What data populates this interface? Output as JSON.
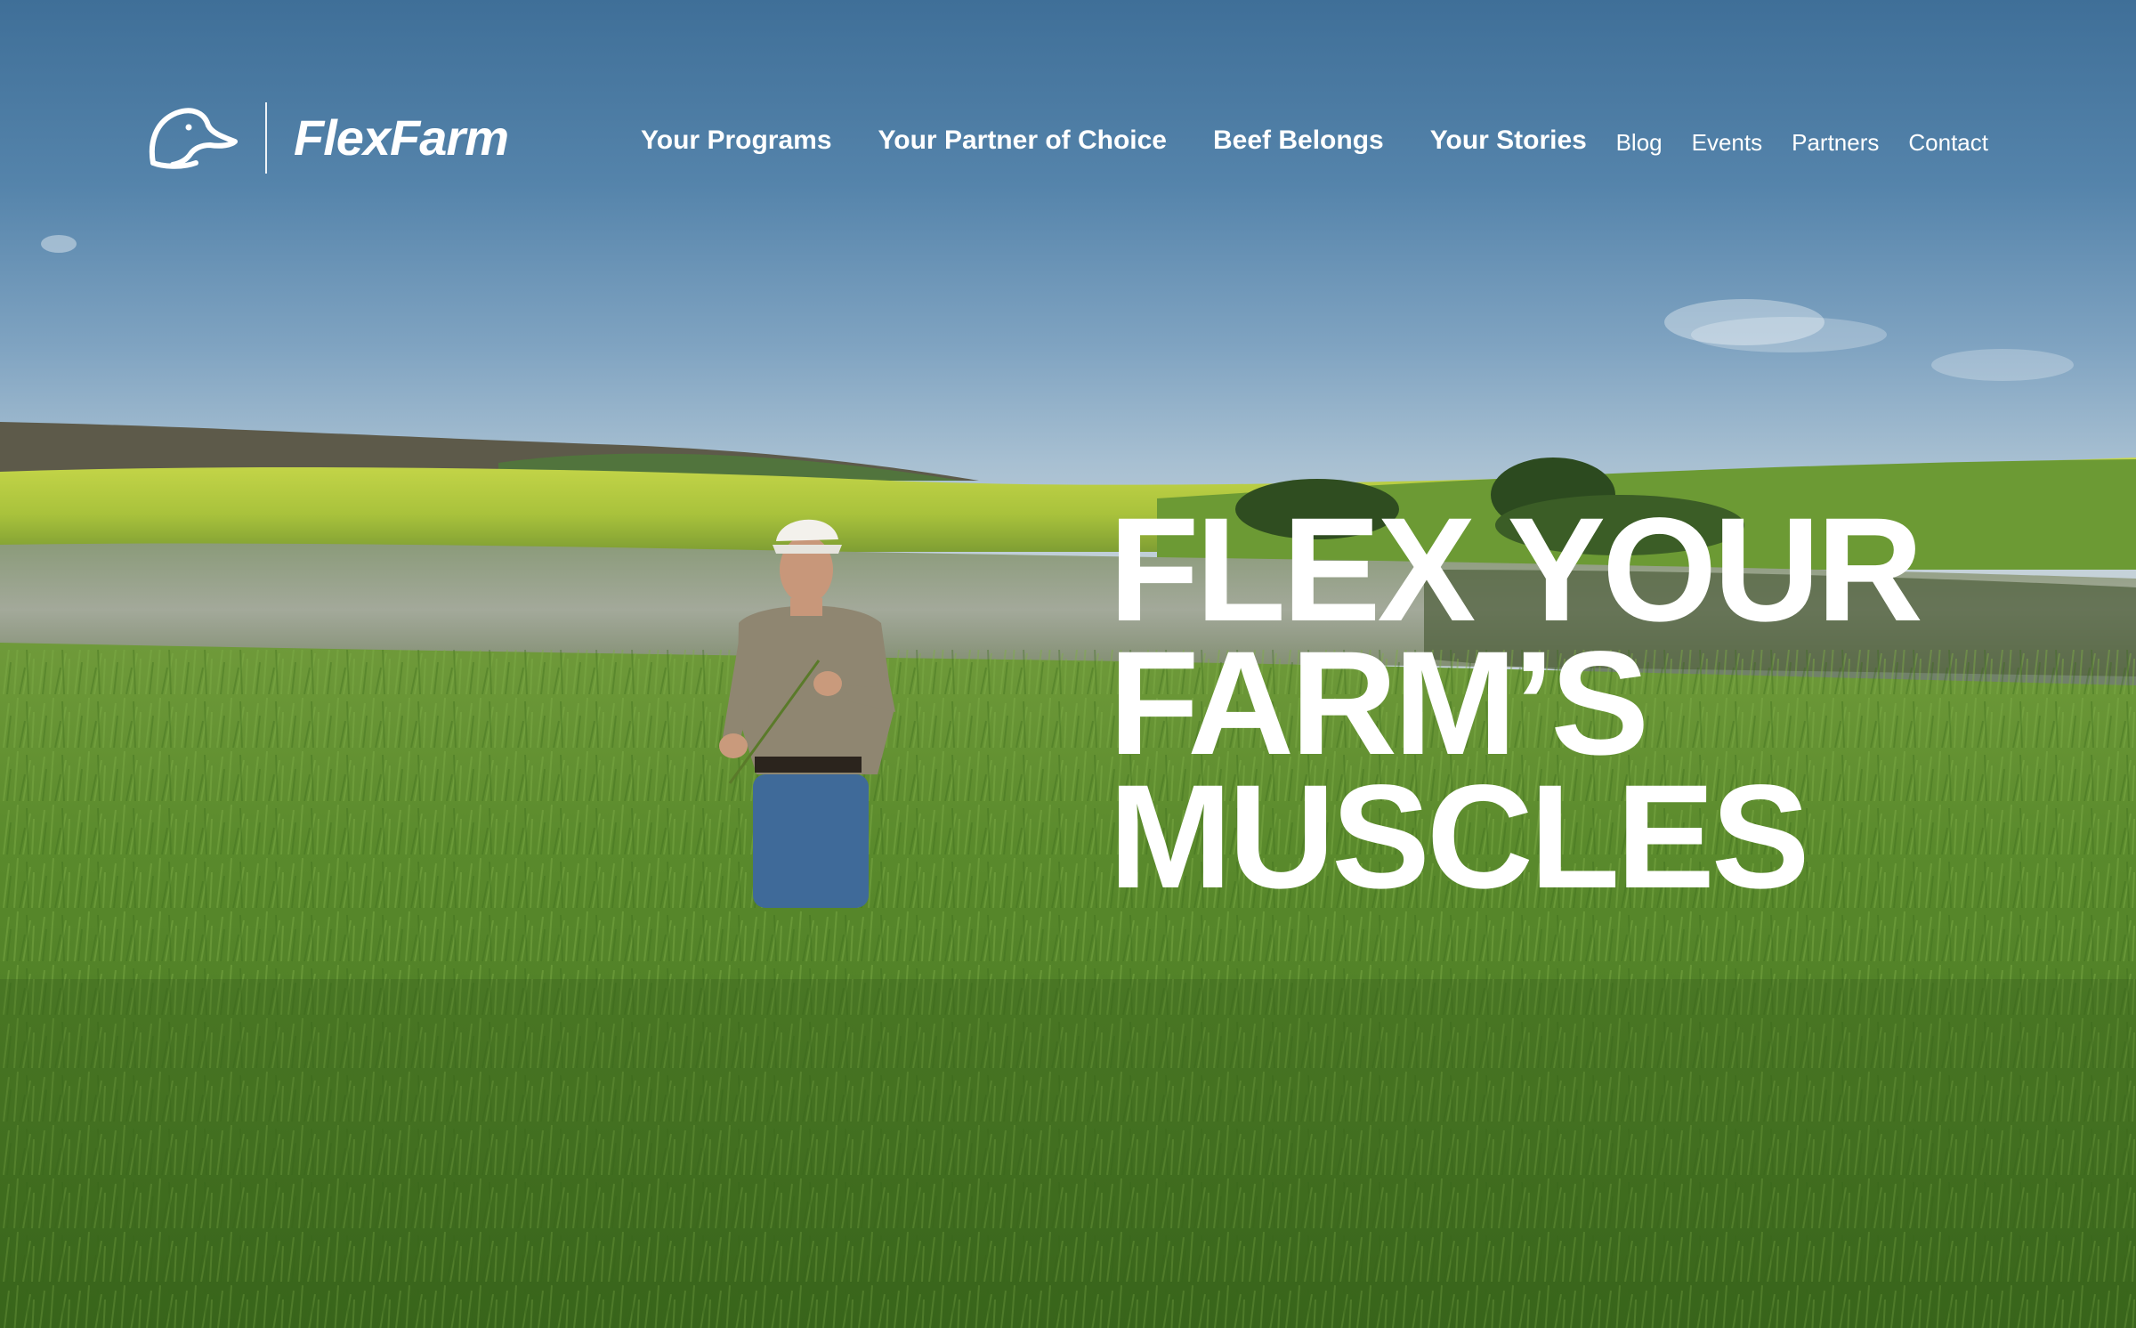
{
  "brand": {
    "logo_icon": "duck-head-icon",
    "wordmark": "FlexFarm"
  },
  "nav": {
    "primary": [
      {
        "label": "Your Programs"
      },
      {
        "label": "Your Partner of Choice"
      },
      {
        "label": "Beef Belongs"
      },
      {
        "label": "Your Stories"
      }
    ],
    "secondary": [
      {
        "label": "Blog"
      },
      {
        "label": "Events"
      },
      {
        "label": "Partners"
      },
      {
        "label": "Contact"
      }
    ]
  },
  "hero": {
    "headline_lines": [
      "FLEX YOUR",
      "FARM’S",
      "MUSCLES"
    ]
  },
  "colors": {
    "sky_top": "#3f6f98",
    "field_green": "#5c8a2c",
    "canola_yellow": "#c9d64a",
    "text": "#ffffff"
  }
}
